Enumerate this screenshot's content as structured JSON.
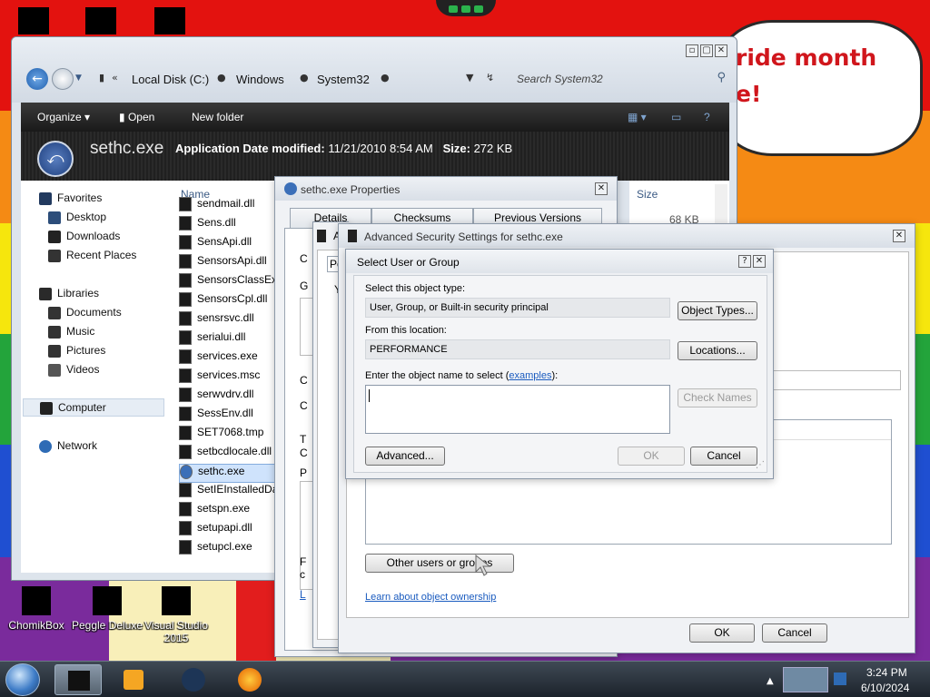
{
  "desktop": {
    "bubble_text": "ride month\ne!",
    "icons": [
      {
        "label": "ChomikBox"
      },
      {
        "label": "Peggle Deluxe"
      },
      {
        "label": "Visual Studio 2015"
      }
    ]
  },
  "explorer": {
    "breadcrumbs": [
      "Local Disk (C:)",
      "Windows",
      "System32"
    ],
    "search_placeholder": "Search System32",
    "toolbar": {
      "organize": "Organize",
      "open": "Open",
      "new_folder": "New folder"
    },
    "details": {
      "name": "sethc.exe",
      "type": "Application",
      "date_label": "Date modified:",
      "date_value": "11/21/2010 8:54 AM",
      "size_label": "Size:",
      "size_value": "272 KB"
    },
    "nav": {
      "favorites": "Favorites",
      "desktop": "Desktop",
      "downloads": "Downloads",
      "recent_places": "Recent Places",
      "libraries": "Libraries",
      "documents": "Documents",
      "music": "Music",
      "pictures": "Pictures",
      "videos": "Videos",
      "computer": "Computer",
      "network": "Network"
    },
    "column_name": "Name",
    "column_size": "Size",
    "size_value_partial": "68 KB",
    "files": [
      "sendmail.dll",
      "Sens.dll",
      "SensApi.dll",
      "SensorsApi.dll",
      "SensorsClassExt",
      "SensorsCpl.dll",
      "sensrsvc.dll",
      "serialui.dll",
      "services.exe",
      "services.msc",
      "serwvdrv.dll",
      "SessEnv.dll",
      "SET7068.tmp",
      "setbcdlocale.dll",
      "sethc.exe",
      "SetIEInstalledDa",
      "setspn.exe",
      "setupapi.dll",
      "setupcl.exe"
    ]
  },
  "properties": {
    "title": "sethc.exe Properties",
    "tabs": [
      "Details",
      "Checksums",
      "Previous Versions"
    ],
    "left_fragments": [
      "C",
      "G",
      "C",
      "C",
      "T",
      "C",
      "P",
      "F",
      "c",
      "L"
    ]
  },
  "advanced": {
    "title": "Advanced Security Settings for sethc.exe",
    "tab_fragment": "Pe",
    "frag_a": "A",
    "frag_y": "Y",
    "other_users_button": "Other users or groups",
    "learn_link": "Learn about object ownership",
    "ok": "OK",
    "cancel": "Cancel"
  },
  "select_user": {
    "title": "Select User or Group",
    "object_type_label": "Select this object type:",
    "object_type_value": "User, Group, or Built-in security principal",
    "object_types_button": "Object Types...",
    "location_label": "From this location:",
    "location_value": "PERFORMANCE",
    "locations_button": "Locations...",
    "enter_label": "Enter the object name to select (",
    "examples_link": "examples",
    "enter_label_end": "):",
    "check_names_button": "Check Names",
    "advanced_button": "Advanced...",
    "ok": "OK",
    "cancel": "Cancel"
  },
  "taskbar": {
    "time": "3:24 PM",
    "date": "6/10/2024"
  }
}
